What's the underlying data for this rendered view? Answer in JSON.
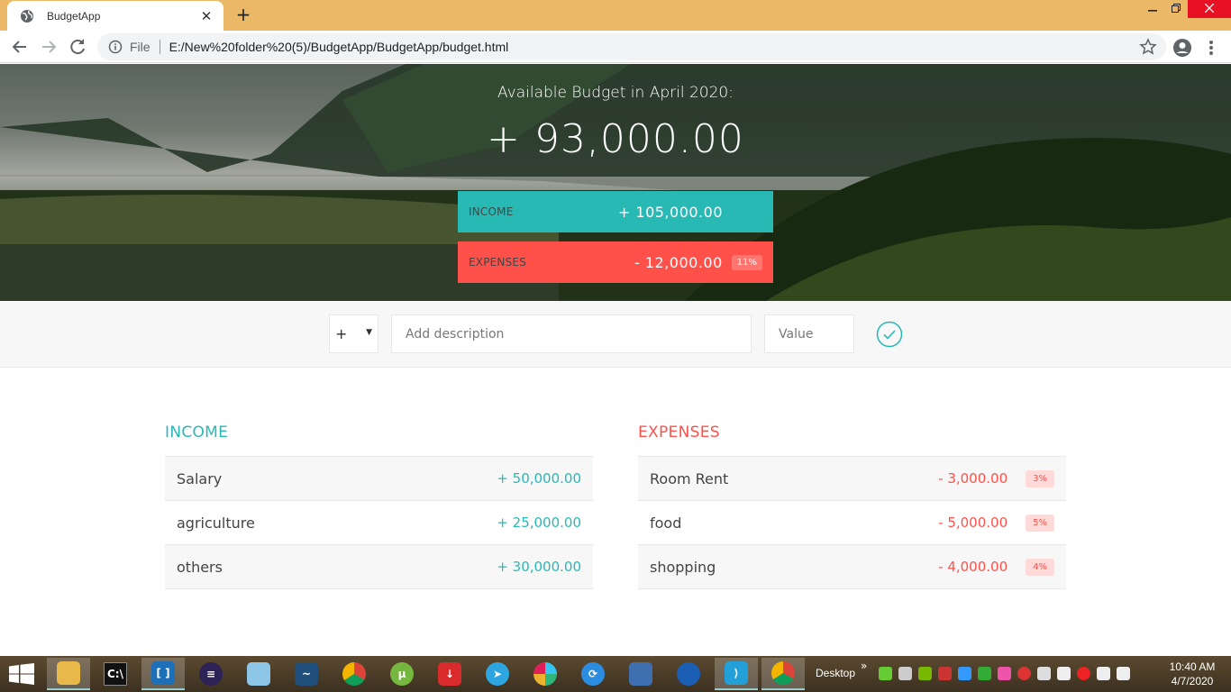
{
  "browser": {
    "tab_title": "BudgetApp",
    "new_tab_symbol": "+",
    "close_symbol": "✕",
    "scheme_label": "File",
    "url": "E:/New%20folder%20(5)/BudgetApp/BudgetApp/budget.html"
  },
  "budget": {
    "title": "Available Budget in April 2020:",
    "value": "+ 93,000.00",
    "income_label": "INCOME",
    "income_value": "+ 105,000.00",
    "expenses_label": "EXPENSES",
    "expenses_value": "- 12,000.00",
    "expenses_percentage": "11%"
  },
  "add_form": {
    "type_value": "+",
    "description_placeholder": "Add description",
    "value_placeholder": "Value"
  },
  "income": {
    "title": "INCOME",
    "items": [
      {
        "description": "Salary",
        "value": "+ 50,000.00"
      },
      {
        "description": "agriculture",
        "value": "+ 25,000.00"
      },
      {
        "description": "others",
        "value": "+ 30,000.00"
      }
    ]
  },
  "expenses": {
    "title": "EXPENSES",
    "items": [
      {
        "description": "Room Rent",
        "value": "- 3,000.00",
        "percentage": "3%"
      },
      {
        "description": "food",
        "value": "- 5,000.00",
        "percentage": "5%"
      },
      {
        "description": "shopping",
        "value": "- 4,000.00",
        "percentage": "4%"
      }
    ]
  },
  "colors": {
    "income": "#28b9b5",
    "expenses": "#ff5049",
    "tab_strip": "#eab866"
  },
  "taskbar": {
    "desktop_label": "Desktop",
    "time": "10:40 AM",
    "date": "4/7/2020",
    "apps": [
      "file-explorer",
      "command-prompt",
      "brackets",
      "eclipse",
      "notepad",
      "mysql-workbench",
      "chrome",
      "utorrent",
      "idm-downloader",
      "telegram",
      "slack",
      "sync-app",
      "remote-desktop",
      "thunderbird",
      "vscode",
      "chrome-active"
    ]
  }
}
